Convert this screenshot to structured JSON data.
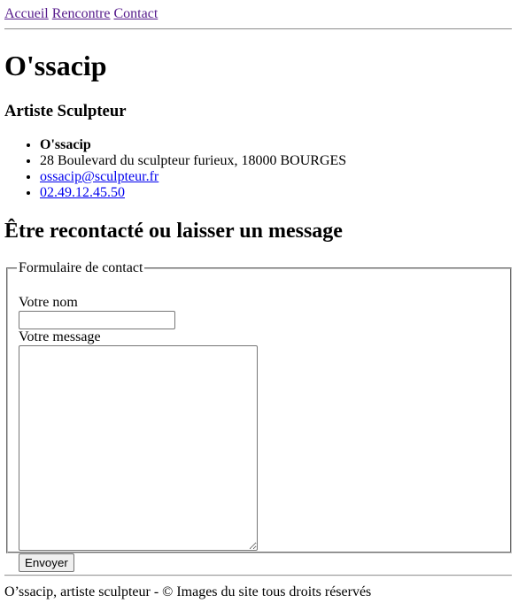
{
  "nav": {
    "items": [
      {
        "label": "Accueil"
      },
      {
        "label": "Rencontre"
      },
      {
        "label": "Contact"
      }
    ]
  },
  "header": {
    "title": "O'ssacip",
    "subtitle": "Artiste Sculpteur"
  },
  "contact_info": {
    "name": "O'ssacip",
    "address": "28 Boulevard du sculpteur furieux, 18000 BOURGES",
    "email": "ossacip@sculpteur.fr",
    "phone": "02.49.12.45.50"
  },
  "section": {
    "title": "Être recontacté ou laisser un message"
  },
  "form": {
    "legend": "Formulaire de contact",
    "name_label": "Votre nom",
    "name_value": "",
    "message_label": "Votre message",
    "message_value": "",
    "submit_label": "Envoyer"
  },
  "footer": {
    "text": "O’ssacip, artiste sculpteur - © Images du site tous droits réservés"
  },
  "colors": {
    "visited_link": "#551a8b",
    "link": "#0000ee"
  }
}
